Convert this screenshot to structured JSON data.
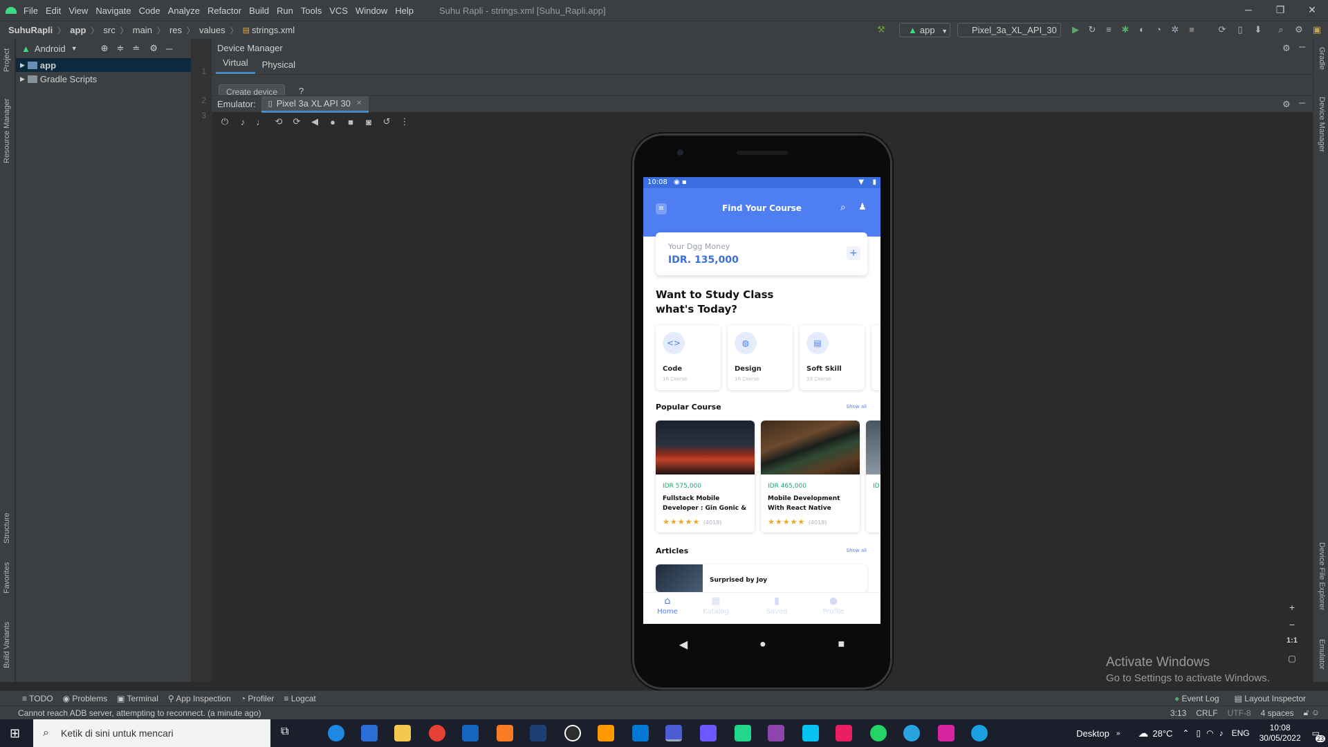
{
  "menubar": {
    "items": [
      "File",
      "Edit",
      "View",
      "Navigate",
      "Code",
      "Analyze",
      "Refactor",
      "Build",
      "Run",
      "Tools",
      "VCS",
      "Window",
      "Help"
    ],
    "window_title": "Suhu Rapli - strings.xml [Suhu_Rapli.app]"
  },
  "breadcrumb": [
    "SuhuRapli",
    "app",
    "src",
    "main",
    "res",
    "values",
    "strings.xml"
  ],
  "toolbar": {
    "run_config": "app",
    "device": "Pixel_3a_XL_API_30"
  },
  "left_strip": [
    "Project",
    "Resource Manager",
    "Structure",
    "Favorites",
    "Build Variants"
  ],
  "right_strip": [
    "Gradle",
    "Device Manager",
    "Device File Explorer",
    "Emulator"
  ],
  "project": {
    "view_mode": "Android",
    "tree": [
      {
        "label": "app",
        "selected": true
      },
      {
        "label": "Gradle Scripts",
        "selected": false
      }
    ]
  },
  "gutter_lines": [
    "1",
    "2",
    "3"
  ],
  "device_manager": {
    "title": "Device Manager",
    "tabs": [
      "Virtual",
      "Physical"
    ],
    "active_tab": "Virtual",
    "create_button": "Create device",
    "help": "?"
  },
  "emulator": {
    "label": "Emulator:",
    "tab": "Pixel 3a XL API 30",
    "zoom_label": "1:1"
  },
  "app": {
    "status_time": "10:08",
    "title": "Find Your Course",
    "money_label": "Your Dgg Money",
    "money_value": "IDR. 135,000",
    "plus": "+",
    "heading_line1": "Want to Study Class",
    "heading_line2": "what's Today?",
    "categories": [
      {
        "name": "Code",
        "sub": "16 Course",
        "icon": "<>"
      },
      {
        "name": "Design",
        "sub": "16 Course",
        "icon": "◍"
      },
      {
        "name": "Soft Skill",
        "sub": "33 Course",
        "icon": "▤"
      }
    ],
    "popular_title": "Popular Course",
    "show_all": "Show all",
    "courses": [
      {
        "price": "IDR 575,000",
        "title": "Fullstack Mobile Developer : Gin Gonic &",
        "rating": "(4018)"
      },
      {
        "price": "IDR 465,000",
        "title": "Mobile Development With React Native",
        "rating": "(4018)"
      }
    ],
    "course3_price": "ID",
    "articles_title": "Articles",
    "article_title": "Surprised by Joy",
    "bottom_nav": [
      "Home",
      "Katalog",
      "Saved",
      "Profile"
    ],
    "stars": "★★★★★"
  },
  "watermark": {
    "line1": "Activate Windows",
    "line2": "Go to Settings to activate Windows."
  },
  "bottom_tools": [
    "TODO",
    "Problems",
    "Terminal",
    "App Inspection",
    "Profiler",
    "Logcat"
  ],
  "bottom_tools_right": [
    "Event Log",
    "Layout Inspector"
  ],
  "status": {
    "message": "Cannot reach ADB server, attempting to reconnect. (a minute ago)",
    "position": "3:13",
    "line_sep": "CRLF",
    "encoding": "UTF-8",
    "indent": "4 spaces"
  },
  "taskbar": {
    "search_placeholder": "Ketik di sini untuk mencari",
    "desktop": "Desktop",
    "temperature": "28°C",
    "lang": "ENG",
    "time": "10:08",
    "date": "30/05/2022",
    "notif": "23"
  }
}
